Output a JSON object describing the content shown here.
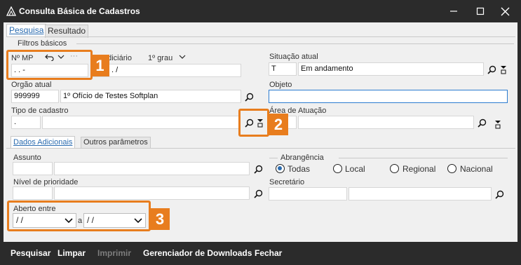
{
  "window": {
    "title": "Consulta Básica de Cadastros"
  },
  "tabs": {
    "pesquisa": "Pesquisa",
    "resultado": "Resultado"
  },
  "filtros": {
    "group_label": "Filtros básicos",
    "nmp_label": "Nº MP",
    "nmp_value": ".   .         -",
    "judiciario_label": "udiciário",
    "grau_label": "1º grau",
    "judiciario_value": "-  .   .  . .   /",
    "situacao_label": "Situação atual",
    "situacao_code": "T",
    "situacao_value": "Em andamento",
    "orgao_label": "Orgão atual",
    "orgao_code": "999999",
    "orgao_value": "1º Ofício de Testes Softplan",
    "objeto_label": "Objeto",
    "objeto_value": "",
    "tipo_label": "Tipo de cadastro",
    "tipo_code": ".",
    "area_label": "Área de Atuação"
  },
  "subtabs": {
    "dados": "Dados Adicionais",
    "outros": "Outros parâmetros"
  },
  "adicionais": {
    "assunto_label": "Assunto",
    "nivel_label": "Nível de prioridade",
    "abrangencia_label": "Abrangência",
    "radio_todas": "Todas",
    "radio_local": "Local",
    "radio_regional": "Regional",
    "radio_nacional": "Nacional",
    "secretario_label": "Secretário",
    "aberto_label": "Aberto entre",
    "date_from": "/ /",
    "date_sep": "a",
    "date_to": "/ /"
  },
  "callouts": [
    "1",
    "2",
    "3"
  ],
  "footer": {
    "pesquisar": "Pesquisar",
    "limpar": "Limpar",
    "imprimir": "Imprimir",
    "downloads": "Gerenciador de Downloads",
    "fechar": "Fechar"
  },
  "colors": {
    "accent": "#e87d1e",
    "link": "#2b6cb0",
    "chrome": "#2b2b2b"
  }
}
